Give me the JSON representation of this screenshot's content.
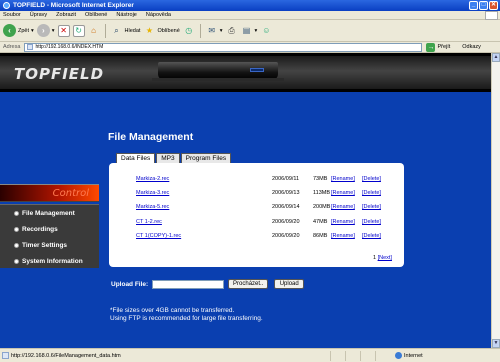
{
  "window": {
    "title": "TOPFIELD - Microsoft Internet Explorer"
  },
  "menu": [
    "Soubor",
    "Úpravy",
    "Zobrazit",
    "Oblíbené",
    "Nástroje",
    "Nápověda"
  ],
  "toolbar": {
    "back_label": "Zpět",
    "search_label": "Hledat",
    "favorites_label": "Oblíbené"
  },
  "address": {
    "label": "Adresa",
    "url": "http://192.168.0.6/INDEX.HTM",
    "go_label": "Přejít",
    "links_label": "Odkazy"
  },
  "brand": {
    "logo": "TOPFIELD"
  },
  "sidebar": {
    "heading": "Control",
    "items": [
      {
        "label": "File Management"
      },
      {
        "label": "Recordings"
      },
      {
        "label": "Timer Settings"
      },
      {
        "label": "System Information"
      }
    ]
  },
  "page": {
    "title": "File Management",
    "tabs": [
      "Data Files",
      "MP3",
      "Program Files"
    ],
    "files": [
      {
        "name": "Markiza-2.rec",
        "date": "2006/09/11",
        "size": "73MB",
        "rename": "[Rename]",
        "delete": "[Delete]"
      },
      {
        "name": "Markiza-3.rec",
        "date": "2006/09/13",
        "size": "113MB",
        "rename": "[Rename]",
        "delete": "[Delete]"
      },
      {
        "name": "Markiza-5.rec",
        "date": "2006/09/14",
        "size": "200MB",
        "rename": "[Rename]",
        "delete": "[Delete]"
      },
      {
        "name": "CT 1-2.rec",
        "date": "2006/09/20",
        "size": "47MB",
        "rename": "[Rename]",
        "delete": "[Delete]"
      },
      {
        "name": "CT 1(COPY)-1.rec",
        "date": "2006/09/20",
        "size": "86MB",
        "rename": "[Rename]",
        "delete": "[Delete]"
      }
    ],
    "pager": {
      "current": "1",
      "next": "[Next]"
    },
    "upload": {
      "label": "Upload File:",
      "browse": "Procházet..",
      "submit": "Upload"
    },
    "notes": [
      "*File sizes over 4GB cannot be transferred.",
      "Using FTP is recommended for large file transferring."
    ]
  },
  "status": {
    "text": "http://192.168.0.6/FileManagement_data.htm",
    "zone": "Internet"
  }
}
